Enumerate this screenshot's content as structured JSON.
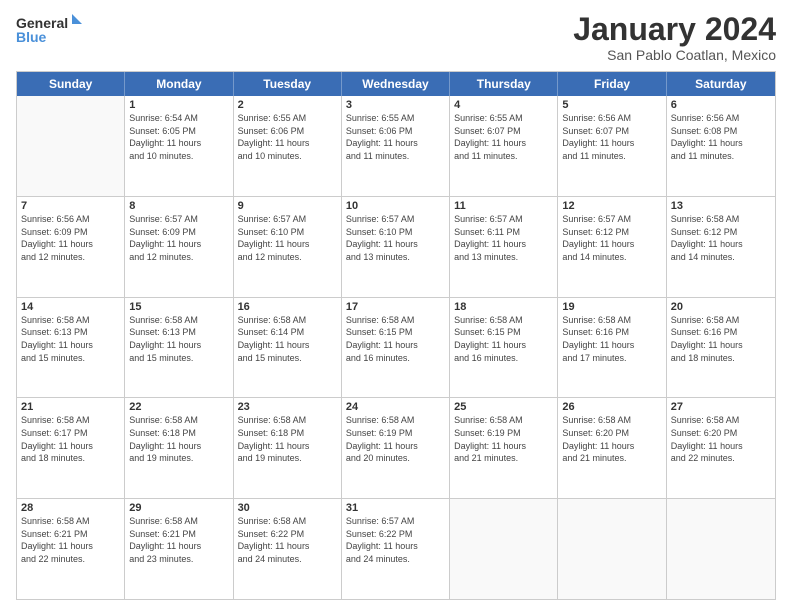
{
  "logo": {
    "line1": "General",
    "line2": "Blue"
  },
  "title": "January 2024",
  "subtitle": "San Pablo Coatlan, Mexico",
  "header_days": [
    "Sunday",
    "Monday",
    "Tuesday",
    "Wednesday",
    "Thursday",
    "Friday",
    "Saturday"
  ],
  "weeks": [
    [
      {
        "day": "",
        "info": ""
      },
      {
        "day": "1",
        "info": "Sunrise: 6:54 AM\nSunset: 6:05 PM\nDaylight: 11 hours\nand 10 minutes."
      },
      {
        "day": "2",
        "info": "Sunrise: 6:55 AM\nSunset: 6:06 PM\nDaylight: 11 hours\nand 10 minutes."
      },
      {
        "day": "3",
        "info": "Sunrise: 6:55 AM\nSunset: 6:06 PM\nDaylight: 11 hours\nand 11 minutes."
      },
      {
        "day": "4",
        "info": "Sunrise: 6:55 AM\nSunset: 6:07 PM\nDaylight: 11 hours\nand 11 minutes."
      },
      {
        "day": "5",
        "info": "Sunrise: 6:56 AM\nSunset: 6:07 PM\nDaylight: 11 hours\nand 11 minutes."
      },
      {
        "day": "6",
        "info": "Sunrise: 6:56 AM\nSunset: 6:08 PM\nDaylight: 11 hours\nand 11 minutes."
      }
    ],
    [
      {
        "day": "7",
        "info": "Sunrise: 6:56 AM\nSunset: 6:09 PM\nDaylight: 11 hours\nand 12 minutes."
      },
      {
        "day": "8",
        "info": "Sunrise: 6:57 AM\nSunset: 6:09 PM\nDaylight: 11 hours\nand 12 minutes."
      },
      {
        "day": "9",
        "info": "Sunrise: 6:57 AM\nSunset: 6:10 PM\nDaylight: 11 hours\nand 12 minutes."
      },
      {
        "day": "10",
        "info": "Sunrise: 6:57 AM\nSunset: 6:10 PM\nDaylight: 11 hours\nand 13 minutes."
      },
      {
        "day": "11",
        "info": "Sunrise: 6:57 AM\nSunset: 6:11 PM\nDaylight: 11 hours\nand 13 minutes."
      },
      {
        "day": "12",
        "info": "Sunrise: 6:57 AM\nSunset: 6:12 PM\nDaylight: 11 hours\nand 14 minutes."
      },
      {
        "day": "13",
        "info": "Sunrise: 6:58 AM\nSunset: 6:12 PM\nDaylight: 11 hours\nand 14 minutes."
      }
    ],
    [
      {
        "day": "14",
        "info": "Sunrise: 6:58 AM\nSunset: 6:13 PM\nDaylight: 11 hours\nand 15 minutes."
      },
      {
        "day": "15",
        "info": "Sunrise: 6:58 AM\nSunset: 6:13 PM\nDaylight: 11 hours\nand 15 minutes."
      },
      {
        "day": "16",
        "info": "Sunrise: 6:58 AM\nSunset: 6:14 PM\nDaylight: 11 hours\nand 15 minutes."
      },
      {
        "day": "17",
        "info": "Sunrise: 6:58 AM\nSunset: 6:15 PM\nDaylight: 11 hours\nand 16 minutes."
      },
      {
        "day": "18",
        "info": "Sunrise: 6:58 AM\nSunset: 6:15 PM\nDaylight: 11 hours\nand 16 minutes."
      },
      {
        "day": "19",
        "info": "Sunrise: 6:58 AM\nSunset: 6:16 PM\nDaylight: 11 hours\nand 17 minutes."
      },
      {
        "day": "20",
        "info": "Sunrise: 6:58 AM\nSunset: 6:16 PM\nDaylight: 11 hours\nand 18 minutes."
      }
    ],
    [
      {
        "day": "21",
        "info": "Sunrise: 6:58 AM\nSunset: 6:17 PM\nDaylight: 11 hours\nand 18 minutes."
      },
      {
        "day": "22",
        "info": "Sunrise: 6:58 AM\nSunset: 6:18 PM\nDaylight: 11 hours\nand 19 minutes."
      },
      {
        "day": "23",
        "info": "Sunrise: 6:58 AM\nSunset: 6:18 PM\nDaylight: 11 hours\nand 19 minutes."
      },
      {
        "day": "24",
        "info": "Sunrise: 6:58 AM\nSunset: 6:19 PM\nDaylight: 11 hours\nand 20 minutes."
      },
      {
        "day": "25",
        "info": "Sunrise: 6:58 AM\nSunset: 6:19 PM\nDaylight: 11 hours\nand 21 minutes."
      },
      {
        "day": "26",
        "info": "Sunrise: 6:58 AM\nSunset: 6:20 PM\nDaylight: 11 hours\nand 21 minutes."
      },
      {
        "day": "27",
        "info": "Sunrise: 6:58 AM\nSunset: 6:20 PM\nDaylight: 11 hours\nand 22 minutes."
      }
    ],
    [
      {
        "day": "28",
        "info": "Sunrise: 6:58 AM\nSunset: 6:21 PM\nDaylight: 11 hours\nand 22 minutes."
      },
      {
        "day": "29",
        "info": "Sunrise: 6:58 AM\nSunset: 6:21 PM\nDaylight: 11 hours\nand 23 minutes."
      },
      {
        "day": "30",
        "info": "Sunrise: 6:58 AM\nSunset: 6:22 PM\nDaylight: 11 hours\nand 24 minutes."
      },
      {
        "day": "31",
        "info": "Sunrise: 6:57 AM\nSunset: 6:22 PM\nDaylight: 11 hours\nand 24 minutes."
      },
      {
        "day": "",
        "info": ""
      },
      {
        "day": "",
        "info": ""
      },
      {
        "day": "",
        "info": ""
      }
    ]
  ]
}
